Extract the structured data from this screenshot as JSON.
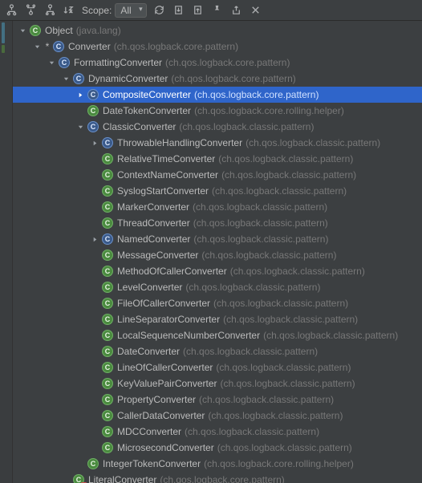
{
  "toolbar": {
    "scope_label": "Scope:",
    "scope_value": "All"
  },
  "tree": [
    {
      "d": 0,
      "expand": "down",
      "star": false,
      "abstract": false,
      "final": false,
      "name": "Object",
      "pkg": "(java.lang)",
      "sel": false
    },
    {
      "d": 1,
      "expand": "down",
      "star": true,
      "abstract": true,
      "final": false,
      "name": "Converter",
      "pkg": "(ch.qos.logback.core.pattern)",
      "sel": false
    },
    {
      "d": 2,
      "expand": "down",
      "star": false,
      "abstract": true,
      "final": false,
      "name": "FormattingConverter",
      "pkg": "(ch.qos.logback.core.pattern)",
      "sel": false
    },
    {
      "d": 3,
      "expand": "down",
      "star": false,
      "abstract": true,
      "final": false,
      "name": "DynamicConverter",
      "pkg": "(ch.qos.logback.core.pattern)",
      "sel": false
    },
    {
      "d": 4,
      "expand": "right",
      "star": false,
      "abstract": true,
      "final": false,
      "name": "CompositeConverter",
      "pkg": "(ch.qos.logback.core.pattern)",
      "sel": true
    },
    {
      "d": 4,
      "expand": null,
      "star": false,
      "abstract": false,
      "final": false,
      "name": "DateTokenConverter",
      "pkg": "(ch.qos.logback.core.rolling.helper)",
      "sel": false
    },
    {
      "d": 4,
      "expand": "down",
      "star": false,
      "abstract": true,
      "final": false,
      "name": "ClassicConverter",
      "pkg": "(ch.qos.logback.classic.pattern)",
      "sel": false
    },
    {
      "d": 5,
      "expand": "right",
      "star": false,
      "abstract": true,
      "final": false,
      "name": "ThrowableHandlingConverter",
      "pkg": "(ch.qos.logback.classic.pattern)",
      "sel": false
    },
    {
      "d": 5,
      "expand": null,
      "star": false,
      "abstract": false,
      "final": false,
      "name": "RelativeTimeConverter",
      "pkg": "(ch.qos.logback.classic.pattern)",
      "sel": false
    },
    {
      "d": 5,
      "expand": null,
      "star": false,
      "abstract": false,
      "final": false,
      "name": "ContextNameConverter",
      "pkg": "(ch.qos.logback.classic.pattern)",
      "sel": false
    },
    {
      "d": 5,
      "expand": null,
      "star": false,
      "abstract": false,
      "final": false,
      "name": "SyslogStartConverter",
      "pkg": "(ch.qos.logback.classic.pattern)",
      "sel": false
    },
    {
      "d": 5,
      "expand": null,
      "star": false,
      "abstract": false,
      "final": false,
      "name": "MarkerConverter",
      "pkg": "(ch.qos.logback.classic.pattern)",
      "sel": false
    },
    {
      "d": 5,
      "expand": null,
      "star": false,
      "abstract": false,
      "final": false,
      "name": "ThreadConverter",
      "pkg": "(ch.qos.logback.classic.pattern)",
      "sel": false
    },
    {
      "d": 5,
      "expand": "right",
      "star": false,
      "abstract": true,
      "final": false,
      "name": "NamedConverter",
      "pkg": "(ch.qos.logback.classic.pattern)",
      "sel": false
    },
    {
      "d": 5,
      "expand": null,
      "star": false,
      "abstract": false,
      "final": false,
      "name": "MessageConverter",
      "pkg": "(ch.qos.logback.classic.pattern)",
      "sel": false
    },
    {
      "d": 5,
      "expand": null,
      "star": false,
      "abstract": false,
      "final": false,
      "name": "MethodOfCallerConverter",
      "pkg": "(ch.qos.logback.classic.pattern)",
      "sel": false
    },
    {
      "d": 5,
      "expand": null,
      "star": false,
      "abstract": false,
      "final": false,
      "name": "LevelConverter",
      "pkg": "(ch.qos.logback.classic.pattern)",
      "sel": false
    },
    {
      "d": 5,
      "expand": null,
      "star": false,
      "abstract": false,
      "final": false,
      "name": "FileOfCallerConverter",
      "pkg": "(ch.qos.logback.classic.pattern)",
      "sel": false
    },
    {
      "d": 5,
      "expand": null,
      "star": false,
      "abstract": false,
      "final": false,
      "name": "LineSeparatorConverter",
      "pkg": "(ch.qos.logback.classic.pattern)",
      "sel": false
    },
    {
      "d": 5,
      "expand": null,
      "star": false,
      "abstract": false,
      "final": false,
      "name": "LocalSequenceNumberConverter",
      "pkg": "(ch.qos.logback.classic.pattern)",
      "sel": false
    },
    {
      "d": 5,
      "expand": null,
      "star": false,
      "abstract": false,
      "final": false,
      "name": "DateConverter",
      "pkg": "(ch.qos.logback.classic.pattern)",
      "sel": false
    },
    {
      "d": 5,
      "expand": null,
      "star": false,
      "abstract": false,
      "final": false,
      "name": "LineOfCallerConverter",
      "pkg": "(ch.qos.logback.classic.pattern)",
      "sel": false
    },
    {
      "d": 5,
      "expand": null,
      "star": false,
      "abstract": false,
      "final": false,
      "name": "KeyValuePairConverter",
      "pkg": "(ch.qos.logback.classic.pattern)",
      "sel": false
    },
    {
      "d": 5,
      "expand": null,
      "star": false,
      "abstract": false,
      "final": false,
      "name": "PropertyConverter",
      "pkg": "(ch.qos.logback.classic.pattern)",
      "sel": false
    },
    {
      "d": 5,
      "expand": null,
      "star": false,
      "abstract": false,
      "final": false,
      "name": "CallerDataConverter",
      "pkg": "(ch.qos.logback.classic.pattern)",
      "sel": false
    },
    {
      "d": 5,
      "expand": null,
      "star": false,
      "abstract": false,
      "final": false,
      "name": "MDCConverter",
      "pkg": "(ch.qos.logback.classic.pattern)",
      "sel": false
    },
    {
      "d": 5,
      "expand": null,
      "star": false,
      "abstract": false,
      "final": false,
      "name": "MicrosecondConverter",
      "pkg": "(ch.qos.logback.classic.pattern)",
      "sel": false
    },
    {
      "d": 4,
      "expand": null,
      "star": false,
      "abstract": false,
      "final": false,
      "name": "IntegerTokenConverter",
      "pkg": "(ch.qos.logback.core.rolling.helper)",
      "sel": false
    },
    {
      "d": 3,
      "expand": null,
      "star": false,
      "abstract": false,
      "final": true,
      "name": "LiteralConverter",
      "pkg": "(ch.qos.logback.core.pattern)",
      "sel": false
    }
  ]
}
